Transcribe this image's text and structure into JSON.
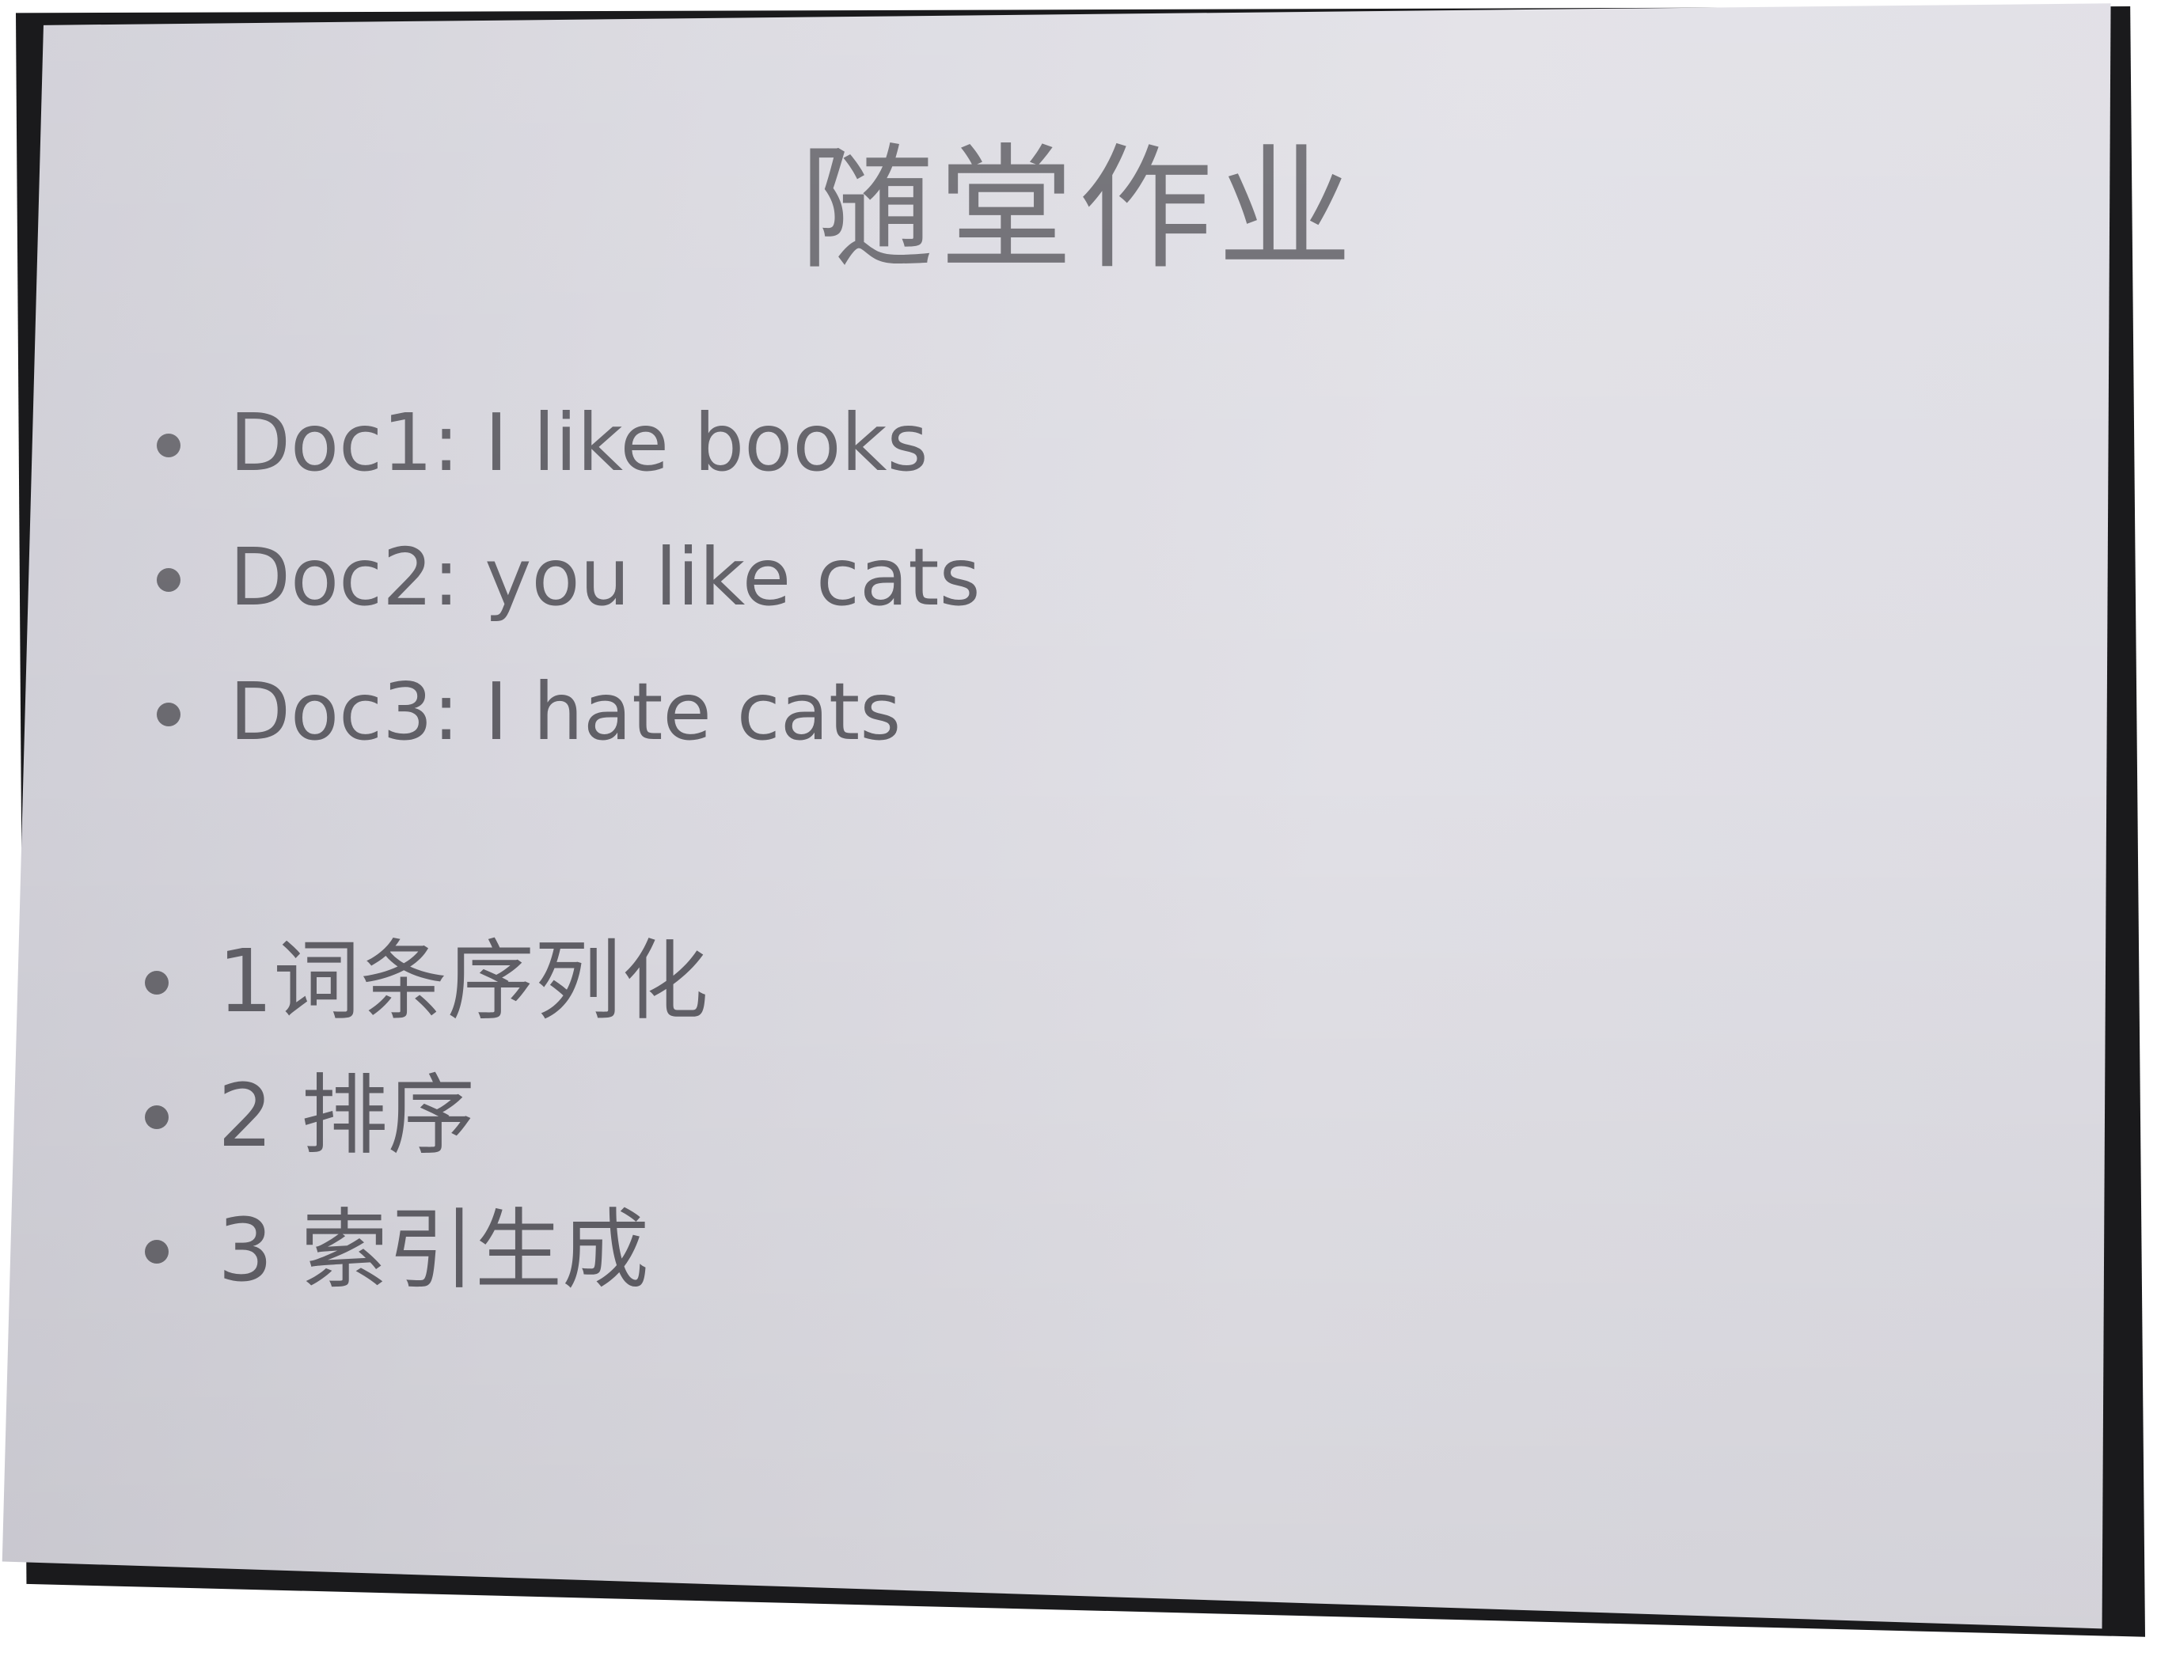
{
  "slide": {
    "title": "随堂作业",
    "documents": [
      {
        "text": "Doc1: I like books"
      },
      {
        "text": "Doc2: you like cats"
      },
      {
        "text": "Doc3: I hate cats"
      }
    ],
    "steps": [
      {
        "text": "1词条序列化"
      },
      {
        "text": "2 排序"
      },
      {
        "text": "3 索引生成"
      }
    ]
  },
  "colors": {
    "slide_background": "#dcdbe1",
    "text": "#605f66",
    "frame": "#1a1a1c"
  }
}
